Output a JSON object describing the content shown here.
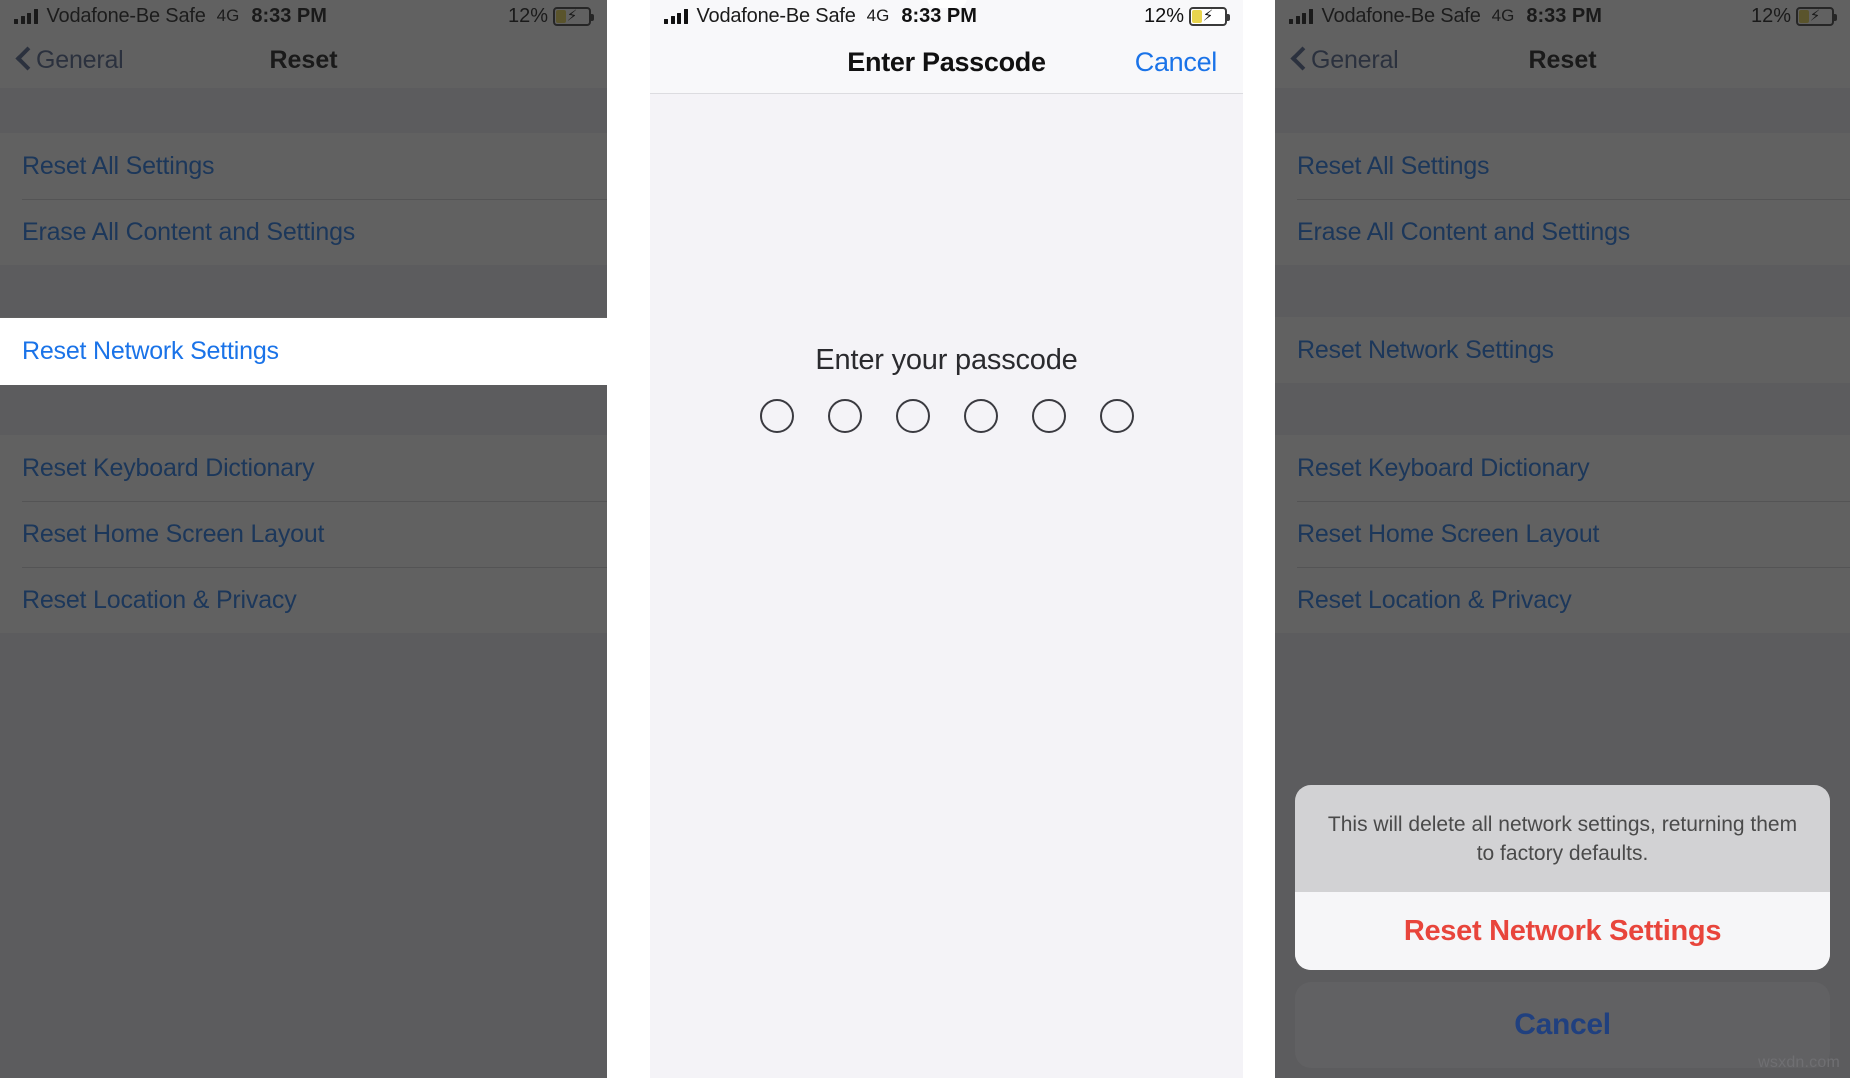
{
  "status_bar": {
    "signal_icon": "signal-bars-icon",
    "carrier": "Vodafone-Be Safe",
    "network": "4G",
    "time": "8:33 PM",
    "battery_percent": "12%",
    "battery_icon": "battery-charging-icon",
    "battery_bolt": "⚡"
  },
  "panel1": {
    "nav": {
      "back_icon": "chevron-left-icon",
      "back_label": "General",
      "title": "Reset"
    },
    "group1": [
      {
        "label": "Reset All Settings"
      },
      {
        "label": "Erase All Content and Settings"
      }
    ],
    "group2": [
      {
        "label": "Reset Network Settings",
        "highlighted": true
      }
    ],
    "group3": [
      {
        "label": "Reset Keyboard Dictionary"
      },
      {
        "label": "Reset Home Screen Layout"
      },
      {
        "label": "Reset Location & Privacy"
      }
    ]
  },
  "panel2": {
    "nav": {
      "title": "Enter Passcode",
      "cancel_label": "Cancel"
    },
    "prompt": "Enter your passcode",
    "passcode_dots": 6,
    "passcode_filled": 0
  },
  "panel3": {
    "nav": {
      "back_icon": "chevron-left-icon",
      "back_label": "General",
      "title": "Reset"
    },
    "group1": [
      {
        "label": "Reset All Settings"
      },
      {
        "label": "Erase All Content and Settings"
      }
    ],
    "group2": [
      {
        "label": "Reset Network Settings"
      }
    ],
    "group3": [
      {
        "label": "Reset Keyboard Dictionary"
      },
      {
        "label": "Reset Home Screen Layout"
      },
      {
        "label": "Reset Location & Privacy"
      }
    ],
    "action_sheet": {
      "message": "This will delete all network settings, returning them to factory defaults.",
      "destructive_label": "Reset Network Settings",
      "cancel_label": "Cancel"
    }
  },
  "watermark": "wsxdn.com",
  "colors": {
    "link_blue": "#1a73e8",
    "destructive_red": "#e8453c",
    "cancel_blue": "#20407f",
    "list_bg": "#efeff4",
    "passcode_bg": "#f4f3f7",
    "battery_yellow": "#e8d44d",
    "dim_overlay": "rgba(30,30,30,0.70)"
  }
}
